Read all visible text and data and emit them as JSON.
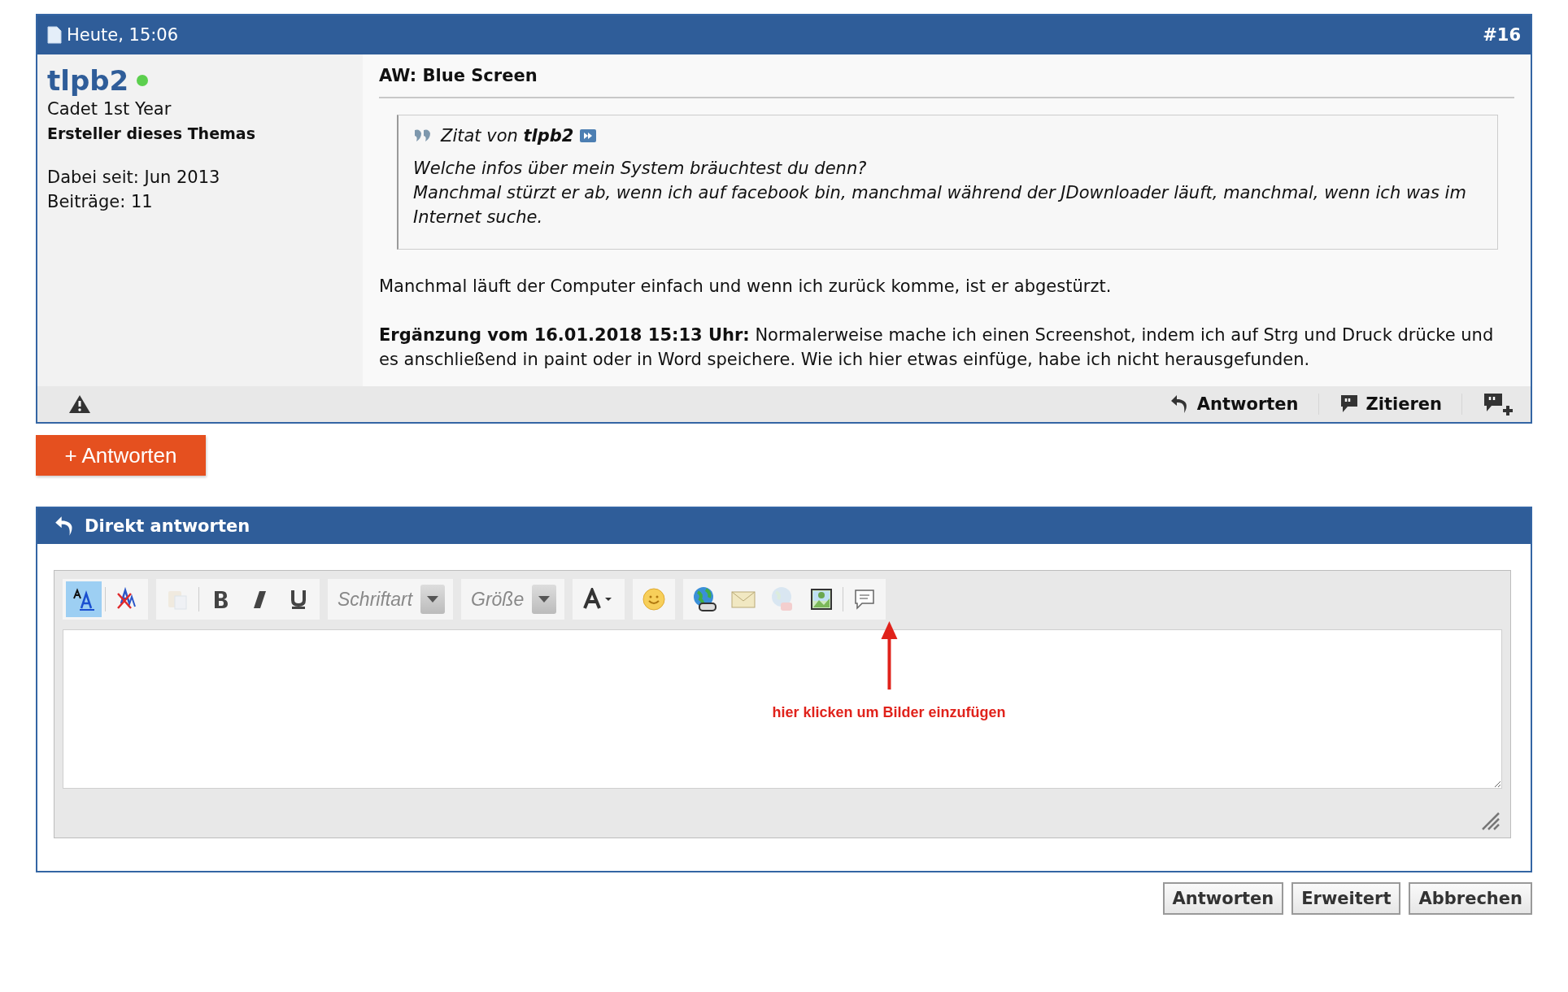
{
  "post": {
    "date": "Heute, 15:06",
    "number": "#16",
    "user": {
      "name": "tlpb2",
      "online": true,
      "rank": "Cadet 1st Year",
      "badge": "Ersteller dieses Themas",
      "joined": "Dabei seit: Jun 2013",
      "posts": "Beiträge: 11"
    },
    "title": "AW: Blue Screen",
    "quote": {
      "label": "Zitat von",
      "author": "tlpb2",
      "lines": [
        "Welche infos über mein System bräuchtest du denn?",
        "Manchmal stürzt er ab, wenn ich auf facebook bin, manchmal während der JDownloader läuft, manchmal, wenn ich was im Internet suche."
      ]
    },
    "paragraphs": [
      "Manchmal läuft der Computer einfach und wenn ich zurück komme, ist er abgestürzt.",
      "**Ergänzung vom 16.01.2018 15:13 Uhr:** Normalerweise mache ich einen Screenshot, indem ich auf Strg und Druck drücke und es anschließend in paint oder in Word speichere. Wie ich hier etwas einfüge, habe ich nicht herausgefunden."
    ],
    "actions": [
      {
        "kind": "reply",
        "label": "Antworten"
      },
      {
        "kind": "quote",
        "label": "Zitieren"
      },
      {
        "kind": "multiquote"
      }
    ]
  },
  "reply_button": "+ Antworten",
  "quick_reply": {
    "title": "Direkt antworten",
    "toolbar": [
      {
        "items": [
          {
            "kind": "switch-mode",
            "selected": true,
            "disabled": false
          },
          {
            "kind": "separator"
          },
          {
            "kind": "remove-format",
            "selected": false,
            "disabled": false
          }
        ]
      },
      {
        "items": [
          {
            "kind": "paste",
            "selected": false,
            "disabled": true
          },
          {
            "kind": "separator"
          },
          {
            "kind": "bold",
            "selected": false,
            "disabled": false
          },
          {
            "kind": "italic",
            "selected": false,
            "disabled": false
          },
          {
            "kind": "underline",
            "selected": false,
            "disabled": false
          }
        ]
      },
      {
        "items": [
          {
            "kind": "select",
            "placeholder": "Schriftart"
          }
        ]
      },
      {
        "items": [
          {
            "kind": "select",
            "placeholder": "Größe"
          }
        ]
      },
      {
        "items": [
          {
            "kind": "font-color",
            "selected": false,
            "disabled": false
          }
        ]
      },
      {
        "items": [
          {
            "kind": "smiley",
            "selected": false,
            "disabled": false
          }
        ]
      },
      {
        "items": [
          {
            "kind": "link",
            "selected": false,
            "disabled": false
          },
          {
            "kind": "email",
            "selected": false,
            "disabled": false
          },
          {
            "kind": "unlink",
            "selected": false,
            "disabled": true
          },
          {
            "kind": "image",
            "selected": false,
            "disabled": false
          },
          {
            "kind": "separator"
          },
          {
            "kind": "quote",
            "selected": false,
            "disabled": false
          }
        ]
      }
    ],
    "annotation": "hier klicken um Bilder einzufügen"
  },
  "form_buttons": [
    "Antworten",
    "Erweitert",
    "Abbrechen"
  ]
}
